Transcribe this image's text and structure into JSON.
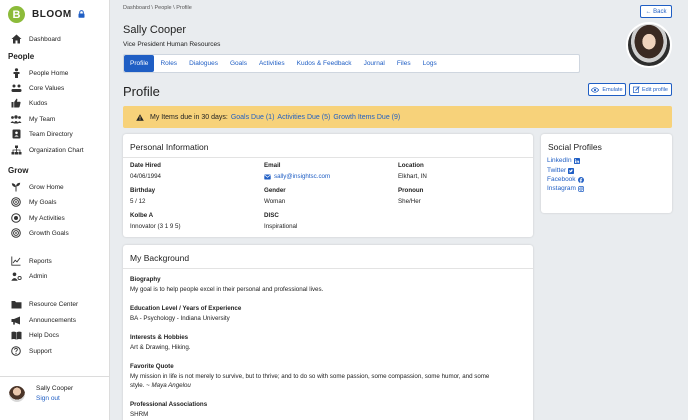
{
  "sidebar": {
    "brand": "BLOOM",
    "logo_letter": "B",
    "items_top": [
      {
        "label": "Dashboard",
        "icon": "home-icon"
      }
    ],
    "people_heading": "People",
    "people_items": [
      {
        "label": "People Home",
        "icon": "person-icon"
      },
      {
        "label": "Core Values",
        "icon": "values-icon"
      },
      {
        "label": "Kudos",
        "icon": "thumbs-up-icon"
      },
      {
        "label": "My Team",
        "icon": "team-icon"
      },
      {
        "label": "Team Directory",
        "icon": "directory-icon"
      },
      {
        "label": "Organization Chart",
        "icon": "org-chart-icon"
      }
    ],
    "grow_heading": "Grow",
    "grow_items": [
      {
        "label": "Grow Home",
        "icon": "sprout-icon"
      },
      {
        "label": "My Goals",
        "icon": "target-icon"
      },
      {
        "label": "My Activities",
        "icon": "activities-icon"
      },
      {
        "label": "Growth Goals",
        "icon": "growth-target-icon"
      }
    ],
    "admin_items": [
      {
        "label": "Reports",
        "icon": "chart-icon"
      },
      {
        "label": "Admin",
        "icon": "admin-icon"
      }
    ],
    "resource_items": [
      {
        "label": "Resource Center",
        "icon": "folder-icon"
      },
      {
        "label": "Announcements",
        "icon": "megaphone-icon"
      },
      {
        "label": "Help Docs",
        "icon": "book-icon"
      },
      {
        "label": "Support",
        "icon": "question-icon"
      }
    ],
    "user": {
      "name": "Sally Cooper",
      "signout": "Sign out"
    }
  },
  "header": {
    "breadcrumb": "Dashboard \\ People \\ Profile",
    "back_label": "← Back",
    "name": "Sally Cooper",
    "title": "Vice President Human Resources"
  },
  "tabs": [
    "Profile",
    "Roles",
    "Dialogues",
    "Goals",
    "Activities",
    "Kudos & Feedback",
    "Journal",
    "Files",
    "Logs"
  ],
  "page": {
    "heading": "Profile",
    "emulate_label": "Emulate",
    "edit_label": "Edit profile"
  },
  "alert": {
    "text": "My Items due in 30 days:",
    "goals": "Goals Due (1)",
    "activities": "Activities Due (5)",
    "growth": "Growth Items Due (9)"
  },
  "personal": {
    "title": "Personal Information",
    "fields": {
      "date_hired": {
        "label": "Date Hired",
        "value": "04/06/1994"
      },
      "email": {
        "label": "Email",
        "value": "sally@insightsc.com"
      },
      "location": {
        "label": "Location",
        "value": "Elkhart, IN"
      },
      "birthday": {
        "label": "Birthday",
        "value": "5 / 12"
      },
      "gender": {
        "label": "Gender",
        "value": "Woman"
      },
      "pronoun": {
        "label": "Pronoun",
        "value": "She/Her"
      },
      "kolbe": {
        "label": "Kolbe A",
        "value": "Innovator (3 1 9 5)"
      },
      "disc": {
        "label": "DISC",
        "value": "Inspirational"
      }
    }
  },
  "social": {
    "title": "Social Profiles",
    "links": [
      {
        "label": "LinkedIn",
        "icon": "linkedin-icon"
      },
      {
        "label": "Twitter",
        "icon": "twitter-icon"
      },
      {
        "label": "Facebook",
        "icon": "facebook-icon"
      },
      {
        "label": "Instagram",
        "icon": "instagram-icon"
      }
    ]
  },
  "background": {
    "title": "My Background",
    "biography_label": "Biography",
    "biography": "My goal is to help people excel in their personal and professional lives.",
    "education_label": "Education Level / Years of Experience",
    "education": "BA - Psychology - Indiana University",
    "interests_label": "Interests & Hobbies",
    "interests": "Art & Drawing, Hiking.",
    "quote_label": "Favorite Quote",
    "quote_line1": "My mission in life is not merely to survive, but to thrive; and to do so with some passion, some compassion, some humor, and some",
    "quote_line2": "style. ~",
    "quote_author": "Maya Angelou",
    "assoc_label": "Professional Associations",
    "assoc": "SHRM"
  },
  "colors": {
    "accent": "#1f5ec4",
    "alert_bg": "#f7d27a",
    "logo_green": "#8cbb3a"
  }
}
